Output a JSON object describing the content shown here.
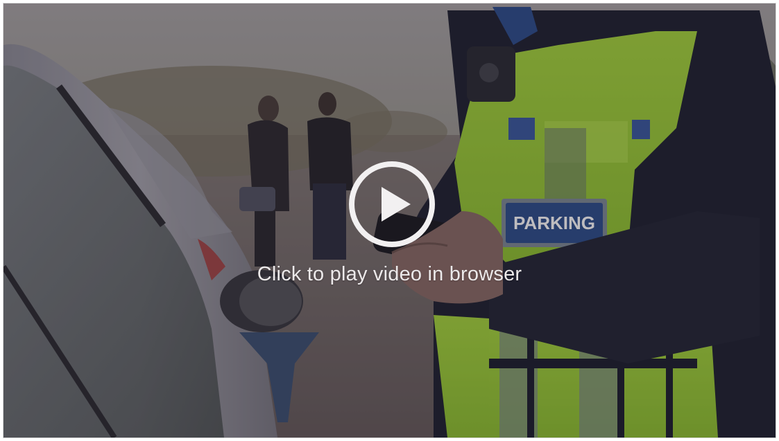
{
  "player": {
    "caption": "Click to play video in browser",
    "play_icon": "play-circle-icon"
  },
  "scene": {
    "badge_text": "PARKING"
  },
  "colors": {
    "hi_vis": "#b6e64a",
    "badge_blue": "#3b6fd0",
    "jacket": "#1f2230",
    "overlay_text": "#ece9ea"
  }
}
